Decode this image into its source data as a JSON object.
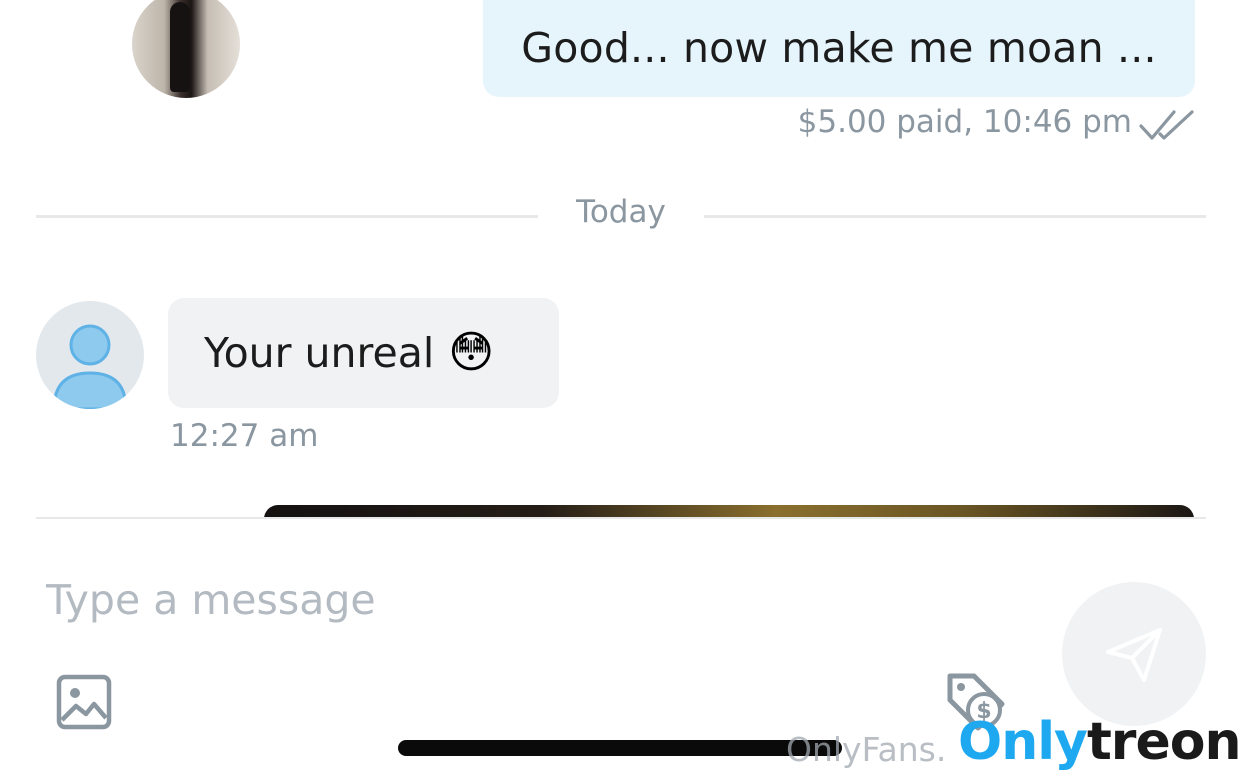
{
  "outgoing_message": {
    "text": "Good... now make me moan ...",
    "meta": "$5.00 paid, 10:46 pm",
    "status_icon": "double-check-icon"
  },
  "date_divider": {
    "label": "Today"
  },
  "incoming_message": {
    "text": "Your unreal",
    "emoji": "😳",
    "time": "12:27 am"
  },
  "composer": {
    "placeholder": "Type a message",
    "value": "",
    "attach_image_icon": "image-icon",
    "price_icon": "price-tag-icon",
    "send_icon": "send-icon"
  },
  "watermark": {
    "onlyfans_text": "OnlyFans.",
    "brand_only": "Only",
    "brand_treon": "treon"
  },
  "colors": {
    "outgoing_bubble": "#e6f5fc",
    "incoming_bubble": "#f0f2f4",
    "meta_text": "#8a96a0",
    "brand_blue": "#1ea8f0"
  }
}
